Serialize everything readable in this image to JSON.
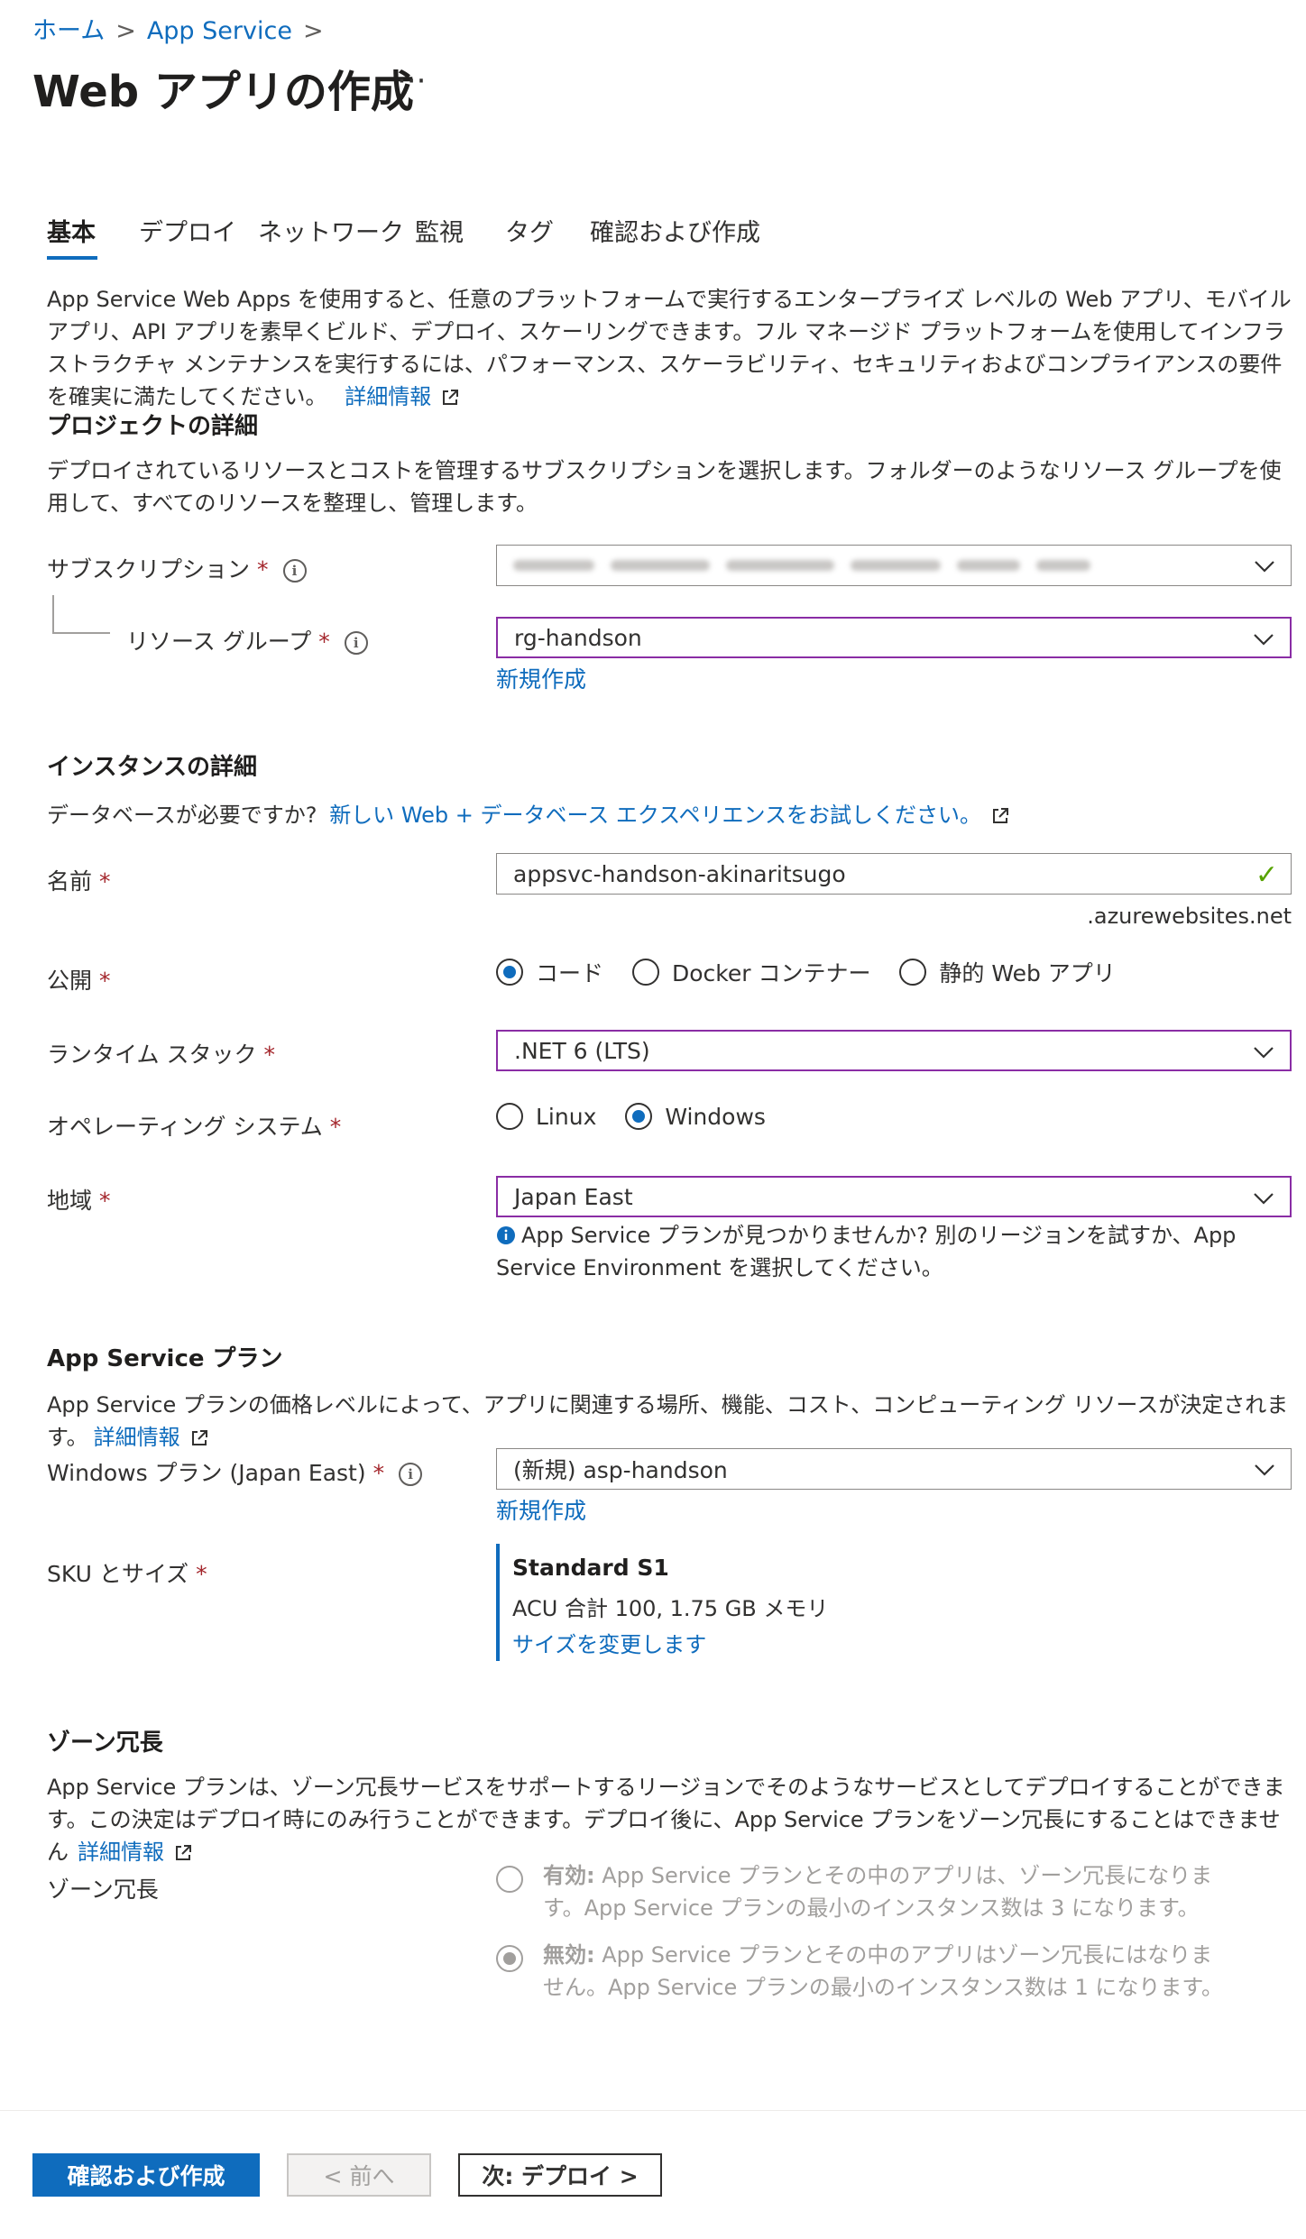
{
  "breadcrumb": {
    "home": "ホーム",
    "service": "App Service"
  },
  "page": {
    "title": "Web アプリの作成",
    "more": "···"
  },
  "tabs": [
    "基本",
    "デプロイ",
    "ネットワーク",
    "監視",
    "タグ",
    "確認および作成"
  ],
  "intro": {
    "text": "App Service Web Apps を使用すると、任意のプラットフォームで実行するエンタープライズ レベルの Web アプリ、モバイル アプリ、API アプリを素早くビルド、デプロイ、スケーリングできます。フル マネージド プラットフォームを使用してインフラストラクチャ メンテナンスを実行するには、パフォーマンス、スケーラビリティ、セキュリティおよびコンプライアンスの要件を確実に満たしてください。",
    "link": "詳細情報"
  },
  "project": {
    "heading": "プロジェクトの詳細",
    "description": "デプロイされているリソースとコストを管理するサブスクリプションを選択します。フォルダーのようなリソース グループを使用して、すべてのリソースを整理し、管理します。",
    "subscription_label": "サブスクリプション",
    "resource_group_label": "リソース グループ",
    "resource_group_value": "rg-handson",
    "create_new": "新規作成"
  },
  "instance": {
    "heading": "インスタンスの詳細",
    "db_prompt": "データベースが必要ですか?",
    "db_link": "新しい Web + データベース エクスペリエンスをお試しください。",
    "name_label": "名前",
    "name_value": "appsvc-handson-akinaritsugo",
    "name_suffix": ".azurewebsites.net",
    "publish_label": "公開",
    "publish_options": [
      "コード",
      "Docker コンテナー",
      "静的 Web アプリ"
    ],
    "publish_selected": "コード",
    "runtime_label": "ランタイム スタック",
    "runtime_value": ".NET 6 (LTS)",
    "os_label": "オペレーティング システム",
    "os_options": [
      "Linux",
      "Windows"
    ],
    "os_selected": "Windows",
    "region_label": "地域",
    "region_value": "Japan East",
    "region_info": "App Service プランが見つかりませんか? 別のリージョンを試すか、App Service Environment を選択してください。"
  },
  "plan": {
    "heading": "App Service プラン",
    "description": "App Service プランの価格レベルによって、アプリに関連する場所、機能、コスト、コンピューティング リソースが決定されます。",
    "link": "詳細情報",
    "windows_plan_label": "Windows プラン (Japan East)",
    "windows_plan_value": "(新規) asp-handson",
    "create_new": "新規作成",
    "sku_label": "SKU とサイズ",
    "sku_name": "Standard S1",
    "sku_detail": "ACU 合計 100, 1.75 GB メモリ",
    "sku_change": "サイズを変更します"
  },
  "zone": {
    "heading": "ゾーン冗長",
    "description": "App Service プランは、ゾーン冗長サービスをサポートするリージョンでそのようなサービスとしてデプロイすることができます。この決定はデプロイ時にのみ行うことができます。デプロイ後に、App Service プランをゾーン冗長にすることはできません",
    "link": "詳細情報",
    "label": "ゾーン冗長",
    "enabled_title": "有効:",
    "enabled_text": "App Service プランとその中のアプリは、ゾーン冗長になります。App Service プランの最小のインスタンス数は 3 になります。",
    "disabled_title": "無効:",
    "disabled_text": "App Service プランとその中のアプリはゾーン冗長にはなりません。App Service プランの最小のインスタンス数は 1 になります。",
    "selected": "無効"
  },
  "footer": {
    "review_create": "確認および作成",
    "previous": "< 前へ",
    "next": "次: デプロイ >"
  },
  "colors": {
    "accent": "#0f6cbd",
    "required": "#a4262c",
    "focus_border": "#8a2da5",
    "valid": "#57a300"
  }
}
